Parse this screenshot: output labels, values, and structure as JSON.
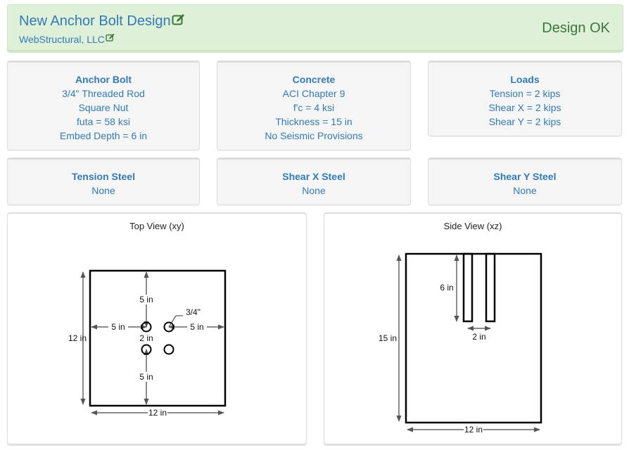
{
  "header": {
    "title": "New Anchor Bolt Design",
    "company": "WebStructural, LLC",
    "status": "Design OK",
    "icons": {
      "edit_title": "edit-icon",
      "edit_company": "edit-icon"
    },
    "colors": {
      "background": "#dff0d8",
      "status": "#3c763d",
      "link": "#337ab7"
    }
  },
  "cards": {
    "anchor_bolt": {
      "title": "Anchor Bolt",
      "lines": [
        "3/4\" Threaded Rod",
        "Square Nut",
        "futa = 58 ksi",
        "Embed Depth = 6 in"
      ]
    },
    "concrete": {
      "title": "Concrete",
      "lines": [
        "ACI Chapter 9",
        "f'c = 4 ksi",
        "Thickness = 15 in",
        "No Seismic Provisions"
      ]
    },
    "loads": {
      "title": "Loads",
      "lines": [
        "Tension = 2 kips",
        "Shear X = 2 kips",
        "Shear Y = 2 kips"
      ]
    },
    "tension_steel": {
      "title": "Tension Steel",
      "lines": [
        "None"
      ]
    },
    "shear_x_steel": {
      "title": "Shear X Steel",
      "lines": [
        "None"
      ]
    },
    "shear_y_steel": {
      "title": "Shear Y Steel",
      "lines": [
        "None"
      ]
    }
  },
  "top_view": {
    "title": "Top View (xy)",
    "width_in": 12,
    "height_in": 12,
    "labels": {
      "width": "12 in",
      "height": "12 in",
      "edge_top": "5 in",
      "edge_bottom": "5 in",
      "edge_left": "5 in",
      "edge_right": "5 in",
      "spacing": "2 in",
      "bolt_dia": "3/4\""
    },
    "bolts_in": [
      [
        5,
        5
      ],
      [
        7,
        5
      ],
      [
        5,
        7
      ],
      [
        7,
        7
      ]
    ]
  },
  "side_view": {
    "title": "Side View (xz)",
    "width_in": 12,
    "thickness_in": 15,
    "embed_in": 6,
    "labels": {
      "width": "12 in",
      "thickness": "15 in",
      "embed": "6 in",
      "spacing": "2 in"
    },
    "bolts_x_in": [
      5,
      7
    ]
  }
}
